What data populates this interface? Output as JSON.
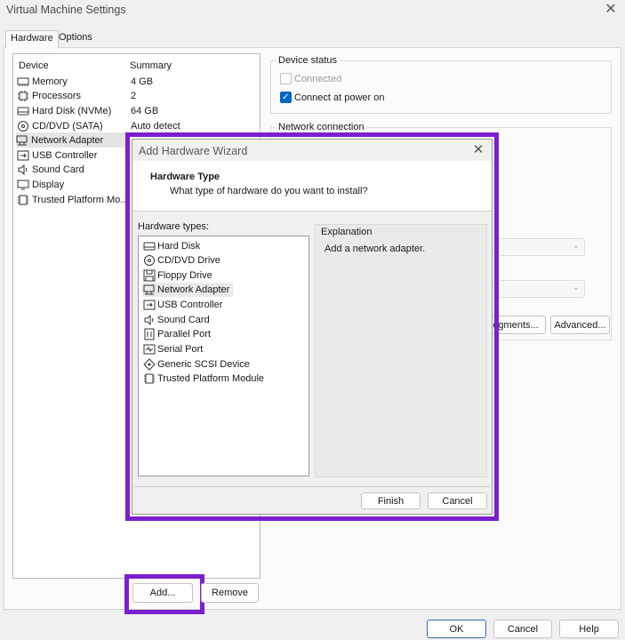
{
  "window": {
    "title": "Virtual Machine Settings"
  },
  "tabs": [
    {
      "label": "Hardware"
    },
    {
      "label": "Options"
    }
  ],
  "device_list": {
    "columns": [
      "Device",
      "Summary"
    ],
    "rows": [
      {
        "name": "Memory",
        "summary": "4 GB",
        "icon": "memory-icon"
      },
      {
        "name": "Processors",
        "summary": "2",
        "icon": "processor-icon"
      },
      {
        "name": "Hard Disk (NVMe)",
        "summary": "64 GB",
        "icon": "hard-disk-icon"
      },
      {
        "name": "CD/DVD (SATA)",
        "summary": "Auto detect",
        "icon": "cd-dvd-icon"
      },
      {
        "name": "Network Adapter",
        "summary": "",
        "icon": "network-adapter-icon"
      },
      {
        "name": "USB Controller",
        "summary": "",
        "icon": "usb-icon"
      },
      {
        "name": "Sound Card",
        "summary": "",
        "icon": "speaker-icon"
      },
      {
        "name": "Display",
        "summary": "",
        "icon": "monitor-icon"
      },
      {
        "name": "Trusted Platform Mo...",
        "summary": "",
        "icon": "tpm-icon"
      }
    ],
    "selected_index": 4
  },
  "device_status": {
    "title": "Device status",
    "connected": {
      "label": "Connected",
      "checked": false,
      "enabled": false
    },
    "connect_at_power_on": {
      "label": "Connect at power on",
      "checked": true
    }
  },
  "network_connection": {
    "title": "Network connection"
  },
  "buttons": {
    "segments": "egments...",
    "advanced": "Advanced...",
    "add": "Add...",
    "remove": "Remove",
    "ok": "OK",
    "cancel": "Cancel",
    "help": "Help"
  },
  "wizard": {
    "title": "Add Hardware Wizard",
    "header_title": "Hardware Type",
    "header_subtitle": "What type of hardware do you want to install?",
    "hardware_types_label": "Hardware types:",
    "hardware_types": [
      {
        "label": "Hard Disk",
        "icon": "hard-disk-icon"
      },
      {
        "label": "CD/DVD Drive",
        "icon": "cd-dvd-icon"
      },
      {
        "label": "Floppy Drive",
        "icon": "floppy-icon"
      },
      {
        "label": "Network Adapter",
        "icon": "network-adapter-icon"
      },
      {
        "label": "USB Controller",
        "icon": "usb-icon"
      },
      {
        "label": "Sound Card",
        "icon": "speaker-icon"
      },
      {
        "label": "Parallel Port",
        "icon": "parallel-port-icon"
      },
      {
        "label": "Serial Port",
        "icon": "serial-port-icon"
      },
      {
        "label": "Generic SCSI Device",
        "icon": "scsi-icon"
      },
      {
        "label": "Trusted Platform Module",
        "icon": "tpm-icon"
      }
    ],
    "selected_index": 3,
    "explanation_label": "Explanation",
    "explanation_text": "Add a network adapter.",
    "finish": "Finish",
    "cancel": "Cancel"
  },
  "colors": {
    "highlight": "#7a1fd0",
    "accent": "#0067c0"
  }
}
